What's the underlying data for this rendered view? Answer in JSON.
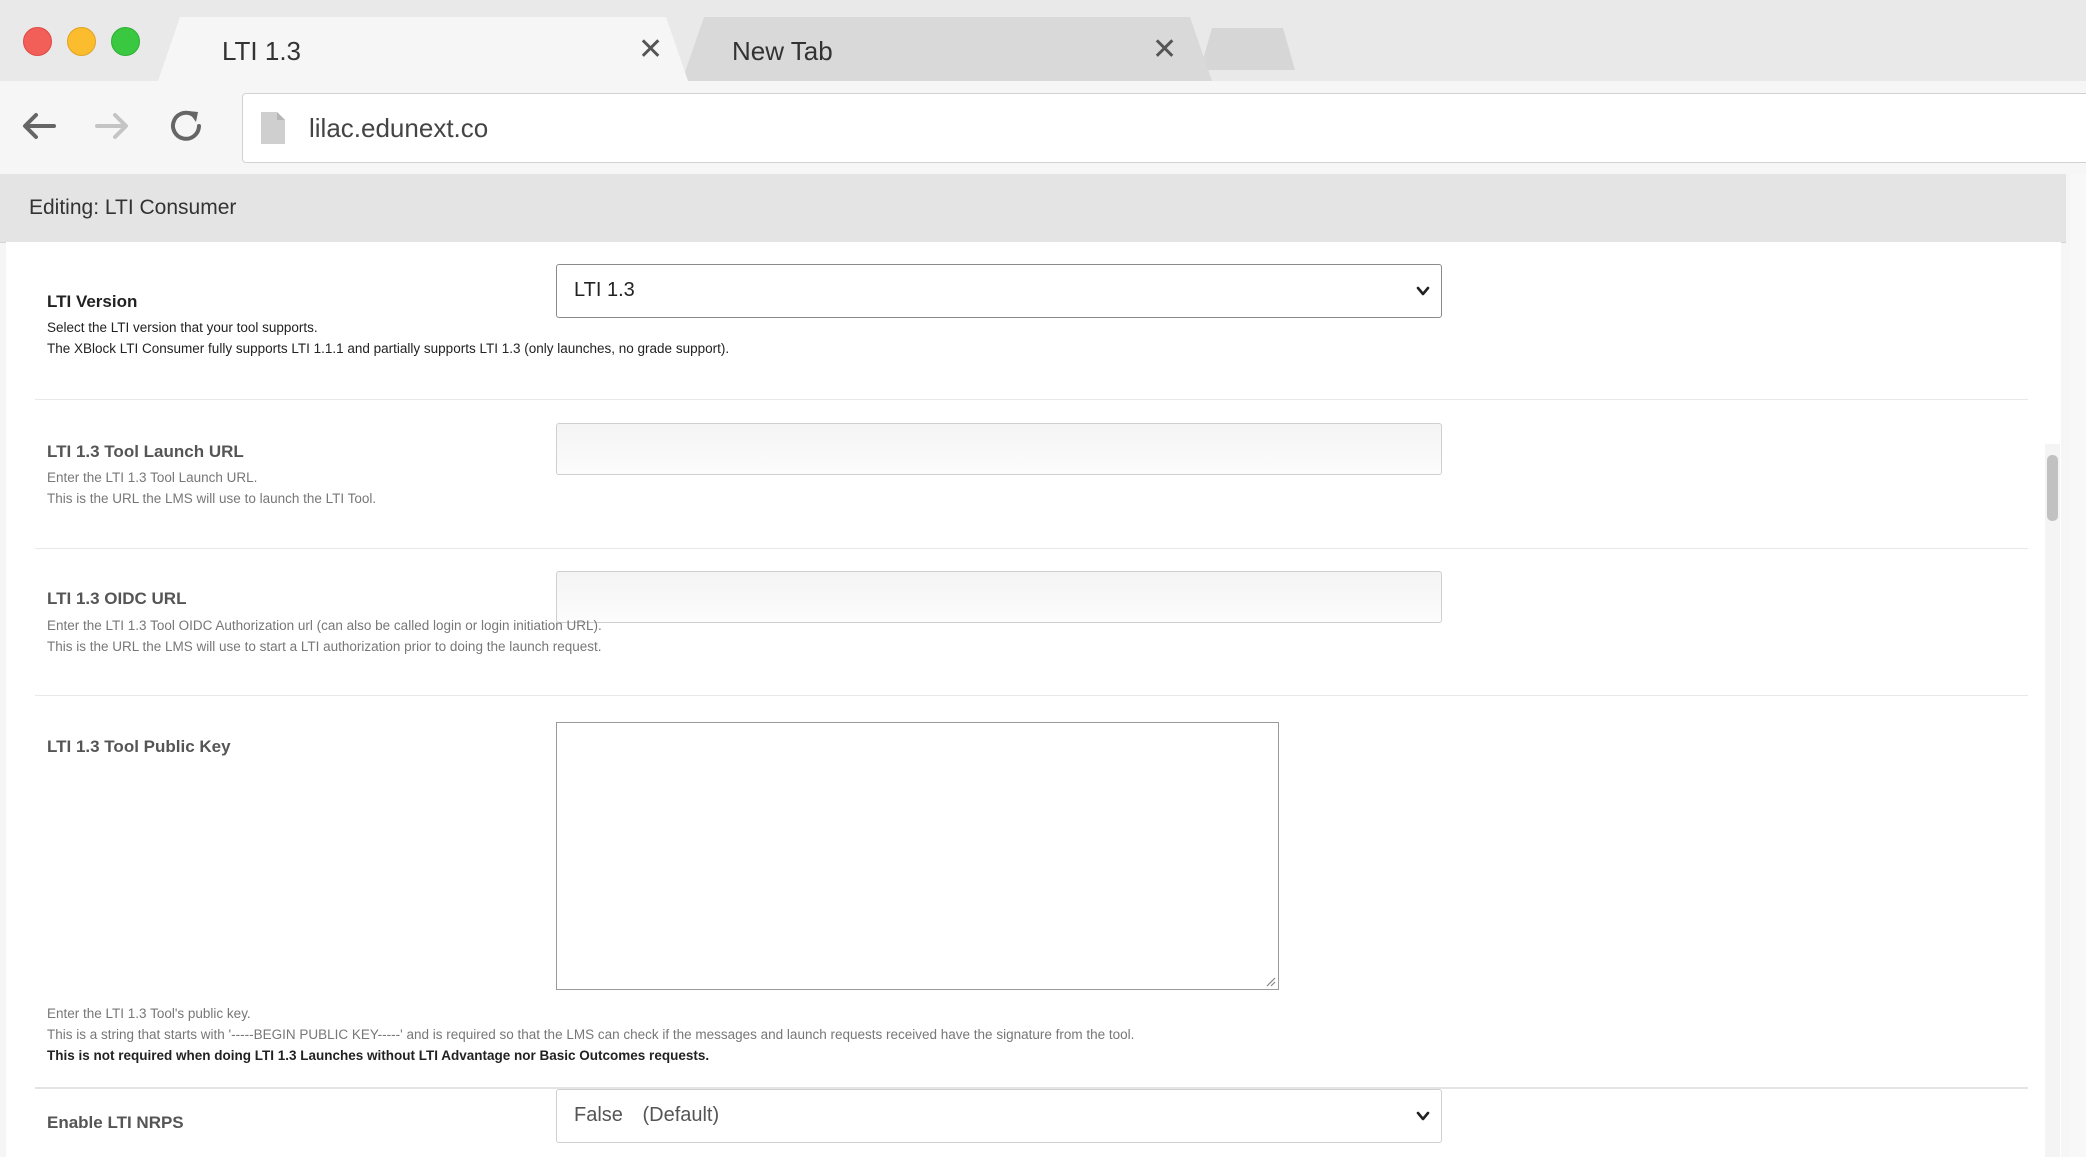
{
  "browser": {
    "tabs": [
      {
        "label": "LTI 1.3",
        "active": true
      },
      {
        "label": "New Tab",
        "active": false
      }
    ],
    "close_glyph": "✕",
    "url": "lilac.edunext.co",
    "icons": [
      "back-arrow-icon",
      "forward-arrow-icon",
      "reload-icon",
      "page-icon"
    ]
  },
  "editor": {
    "title": "Editing: LTI Consumer",
    "fields": {
      "lti_version": {
        "label": "LTI Version",
        "value": "LTI 1.3",
        "help": [
          "Select the LTI version that your tool supports.",
          "The XBlock LTI Consumer fully supports LTI 1.1.1 and partially supports LTI 1.3 (only launches, no grade support)."
        ]
      },
      "launch_url": {
        "label": "LTI 1.3 Tool Launch URL",
        "value": "",
        "help": [
          "Enter the LTI 1.3 Tool Launch URL.",
          "This is the URL the LMS will use to launch the LTI Tool."
        ]
      },
      "oidc_url": {
        "label": "LTI 1.3 OIDC URL",
        "value": "",
        "help": [
          "Enter the LTI 1.3 Tool OIDC Authorization url (can also be called login or login initiation URL).",
          "This is the URL the LMS will use to start a LTI authorization prior to doing the launch request."
        ]
      },
      "public_key": {
        "label": "LTI 1.3 Tool Public Key",
        "value": "",
        "help": [
          "Enter the LTI 1.3 Tool's public key.",
          "This is a string that starts with '-----BEGIN PUBLIC KEY-----' and is required so that the LMS can check if the messages and launch requests received have the signature from the tool.",
          "This is not required when doing LTI 1.3 Launches without LTI Advantage nor Basic Outcomes requests."
        ]
      },
      "nrps": {
        "label": "Enable LTI NRPS",
        "value": "False (Default)"
      }
    }
  },
  "colors": {
    "traffic_red": "#f25f58",
    "traffic_yellow": "#fbbd2e",
    "traffic_green": "#39c840",
    "editing_bar": "#e4e4e4"
  }
}
